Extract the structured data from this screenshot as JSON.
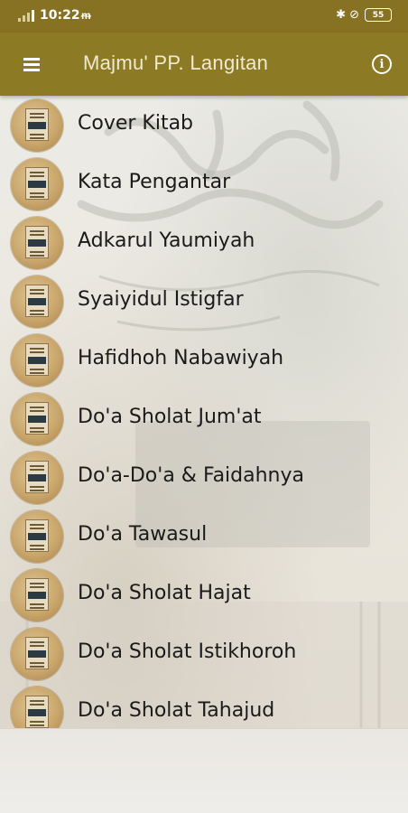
{
  "status_bar": {
    "time": "10:22",
    "extra_icon": "ᵯ",
    "bluetooth_icon": "bluetooth-icon",
    "battery_level": "55",
    "right_icons": "✱ ⊘"
  },
  "app_bar": {
    "title": "Majmu' PP. Langitan",
    "menu_icon": "menu-icon",
    "info_icon": "info-icon",
    "info_glyph": "i"
  },
  "colors": {
    "app_bar": "#8d7a25",
    "status_bar": "#867222",
    "text": "#1a1a1a"
  },
  "list": {
    "items": [
      {
        "label": "Cover Kitab"
      },
      {
        "label": "Kata Pengantar"
      },
      {
        "label": "Adkarul Yaumiyah"
      },
      {
        "label": "Syaiyidul Istigfar"
      },
      {
        "label": "Hafidhoh Nabawiyah"
      },
      {
        "label": "Do'a Sholat Jum'at"
      },
      {
        "label": "Do'a-Do'a & Faidahnya"
      },
      {
        "label": "Do'a Tawasul"
      },
      {
        "label": "Do'a Sholat Hajat"
      },
      {
        "label": "Do'a Sholat Istikhoroh"
      },
      {
        "label": "Do'a Sholat Tahajud"
      }
    ]
  }
}
